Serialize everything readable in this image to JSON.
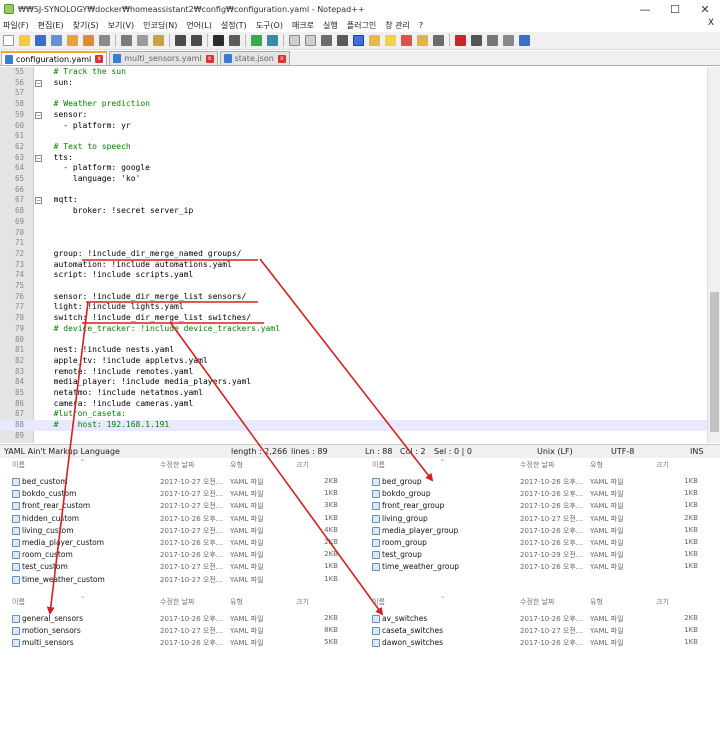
{
  "window": {
    "title": "₩₩SJ-SYNOLOGY₩docker₩homeassistant2₩config₩configuration.yaml - Notepad++",
    "minimize": "—",
    "maximize": "☐",
    "close": "✕"
  },
  "menu": [
    "파일(F)",
    "편집(E)",
    "찾기(S)",
    "보기(V)",
    "인코딩(N)",
    "언어(L)",
    "설정(T)",
    "도구(O)",
    "매크로",
    "실행",
    "플러그인",
    "창 관리",
    "?"
  ],
  "menu_close": "X",
  "tabs": [
    {
      "label": "configuration.yaml",
      "active": true
    },
    {
      "label": "multi_sensors.yaml",
      "active": false
    },
    {
      "label": "state.json",
      "active": false
    }
  ],
  "editor": {
    "lines": [
      {
        "n": "55",
        "text": "  # Track the sun",
        "kind": "comment"
      },
      {
        "n": "56",
        "text": "  sun:",
        "kind": "code"
      },
      {
        "n": "57",
        "text": "",
        "kind": "code"
      },
      {
        "n": "58",
        "text": "  # Weather prediction",
        "kind": "comment"
      },
      {
        "n": "59",
        "text": "  sensor:",
        "kind": "code"
      },
      {
        "n": "60",
        "text": "    - platform: yr",
        "kind": "code"
      },
      {
        "n": "61",
        "text": "",
        "kind": "code"
      },
      {
        "n": "62",
        "text": "  # Text to speech",
        "kind": "comment"
      },
      {
        "n": "63",
        "text": "  tts:",
        "kind": "code"
      },
      {
        "n": "64",
        "text": "    - platform: google",
        "kind": "code"
      },
      {
        "n": "65",
        "text": "      language: 'ko'",
        "kind": "code"
      },
      {
        "n": "66",
        "text": "",
        "kind": "code"
      },
      {
        "n": "67",
        "text": "  mqtt:",
        "kind": "code"
      },
      {
        "n": "68",
        "text": "      broker: !secret server_ip",
        "kind": "code"
      },
      {
        "n": "69",
        "text": "",
        "kind": "code"
      },
      {
        "n": "70",
        "text": "",
        "kind": "code"
      },
      {
        "n": "71",
        "text": "",
        "kind": "code"
      },
      {
        "n": "72",
        "text": "  group: !include_dir_merge_named groups/",
        "kind": "code"
      },
      {
        "n": "73",
        "text": "  automation: !include automations.yaml",
        "kind": "code"
      },
      {
        "n": "74",
        "text": "  script: !include scripts.yaml",
        "kind": "code"
      },
      {
        "n": "75",
        "text": "",
        "kind": "code"
      },
      {
        "n": "76",
        "text": "  sensor: !include_dir_merge_list sensors/",
        "kind": "code"
      },
      {
        "n": "77",
        "text": "  light: !include lights.yaml",
        "kind": "code"
      },
      {
        "n": "78",
        "text": "  switch: !include_dir_merge_list switches/",
        "kind": "code"
      },
      {
        "n": "79",
        "text": "  # device_tracker: !include device_trackers.yaml",
        "kind": "comment"
      },
      {
        "n": "80",
        "text": "",
        "kind": "code"
      },
      {
        "n": "81",
        "text": "  nest: !include nests.yaml",
        "kind": "code"
      },
      {
        "n": "82",
        "text": "  apple_tv: !include appletvs.yaml",
        "kind": "code"
      },
      {
        "n": "83",
        "text": "  remote: !include remotes.yaml",
        "kind": "code"
      },
      {
        "n": "84",
        "text": "  media_player: !include media_players.yaml",
        "kind": "code"
      },
      {
        "n": "85",
        "text": "  netatmo: !include netatmos.yaml",
        "kind": "code"
      },
      {
        "n": "86",
        "text": "  camera: !include cameras.yaml",
        "kind": "code"
      },
      {
        "n": "87",
        "text": "  #lutron_caseta:",
        "kind": "comment"
      },
      {
        "n": "88",
        "text": "  #    host: 192.168.1.191",
        "kind": "comment"
      },
      {
        "n": "89",
        "text": "",
        "kind": "code"
      }
    ],
    "current_line": "88"
  },
  "status": {
    "language": "YAML Ain't Markup Language",
    "length": "length : 2,266",
    "lines": "lines : 89",
    "ln": "Ln : 88",
    "col": "Col : 2",
    "sel": "Sel : 0 | 0",
    "eol": "Unix (LF)",
    "encoding": "UTF-8",
    "mode": "INS"
  },
  "explorer": {
    "headers": {
      "name": "이름",
      "date": "수정한 날짜",
      "type": "유형",
      "size": "크기"
    },
    "customize_pane": [
      {
        "name": "bed_custom",
        "date": "2017-10-27 오전...",
        "type": "YAML 파일",
        "size": "2KB"
      },
      {
        "name": "bokdo_custom",
        "date": "2017-10-27 오전...",
        "type": "YAML 파일",
        "size": "1KB"
      },
      {
        "name": "front_rear_custom",
        "date": "2017-10-27 오전...",
        "type": "YAML 파일",
        "size": "3KB"
      },
      {
        "name": "hidden_custom",
        "date": "2017-10-26 오후...",
        "type": "YAML 파일",
        "size": "1KB"
      },
      {
        "name": "living_custom",
        "date": "2017-10-27 오전...",
        "type": "YAML 파일",
        "size": "4KB"
      },
      {
        "name": "media_player_custom",
        "date": "2017-10-26 오후...",
        "type": "YAML 파일",
        "size": "2KB"
      },
      {
        "name": "room_custom",
        "date": "2017-10-26 오후...",
        "type": "YAML 파일",
        "size": "2KB"
      },
      {
        "name": "test_custom",
        "date": "2017-10-27 오전...",
        "type": "YAML 파일",
        "size": "1KB"
      },
      {
        "name": "time_weather_custom",
        "date": "2017-10-27 오전...",
        "type": "YAML 파일",
        "size": "1KB"
      }
    ],
    "groups_pane": [
      {
        "name": "bed_group",
        "date": "2017-10-26 오후...",
        "type": "YAML 파일",
        "size": "1KB"
      },
      {
        "name": "bokdo_group",
        "date": "2017-10-26 오후...",
        "type": "YAML 파일",
        "size": "1KB"
      },
      {
        "name": "front_rear_group",
        "date": "2017-10-26 오후...",
        "type": "YAML 파일",
        "size": "1KB"
      },
      {
        "name": "living_group",
        "date": "2017-10-27 오전...",
        "type": "YAML 파일",
        "size": "2KB"
      },
      {
        "name": "media_player_group",
        "date": "2017-10-26 오후...",
        "type": "YAML 파일",
        "size": "1KB"
      },
      {
        "name": "room_group",
        "date": "2017-10-26 오후...",
        "type": "YAML 파일",
        "size": "1KB"
      },
      {
        "name": "test_group",
        "date": "2017-10-29 오전...",
        "type": "YAML 파일",
        "size": "1KB"
      },
      {
        "name": "time_weather_group",
        "date": "2017-10-26 오후...",
        "type": "YAML 파일",
        "size": "1KB"
      }
    ],
    "sensors_pane": [
      {
        "name": "general_sensors",
        "date": "2017-10-26 오후...",
        "type": "YAML 파일",
        "size": "2KB"
      },
      {
        "name": "motion_sensors",
        "date": "2017-10-27 오전...",
        "type": "YAML 파일",
        "size": "8KB"
      },
      {
        "name": "multi_sensors",
        "date": "2017-10-26 오후...",
        "type": "YAML 파일",
        "size": "5KB"
      }
    ],
    "switches_pane": [
      {
        "name": "av_switches",
        "date": "2017-10-26 오후...",
        "type": "YAML 파일",
        "size": "2KB"
      },
      {
        "name": "caseta_switches",
        "date": "2017-10-27 오전...",
        "type": "YAML 파일",
        "size": "1KB"
      },
      {
        "name": "dawon_switches",
        "date": "2017-10-26 오후...",
        "type": "YAML 파일",
        "size": "1KB"
      }
    ]
  },
  "colors": {
    "annotation": "#d62020",
    "comment": "#008000",
    "tab_accent": "#f5a623"
  }
}
